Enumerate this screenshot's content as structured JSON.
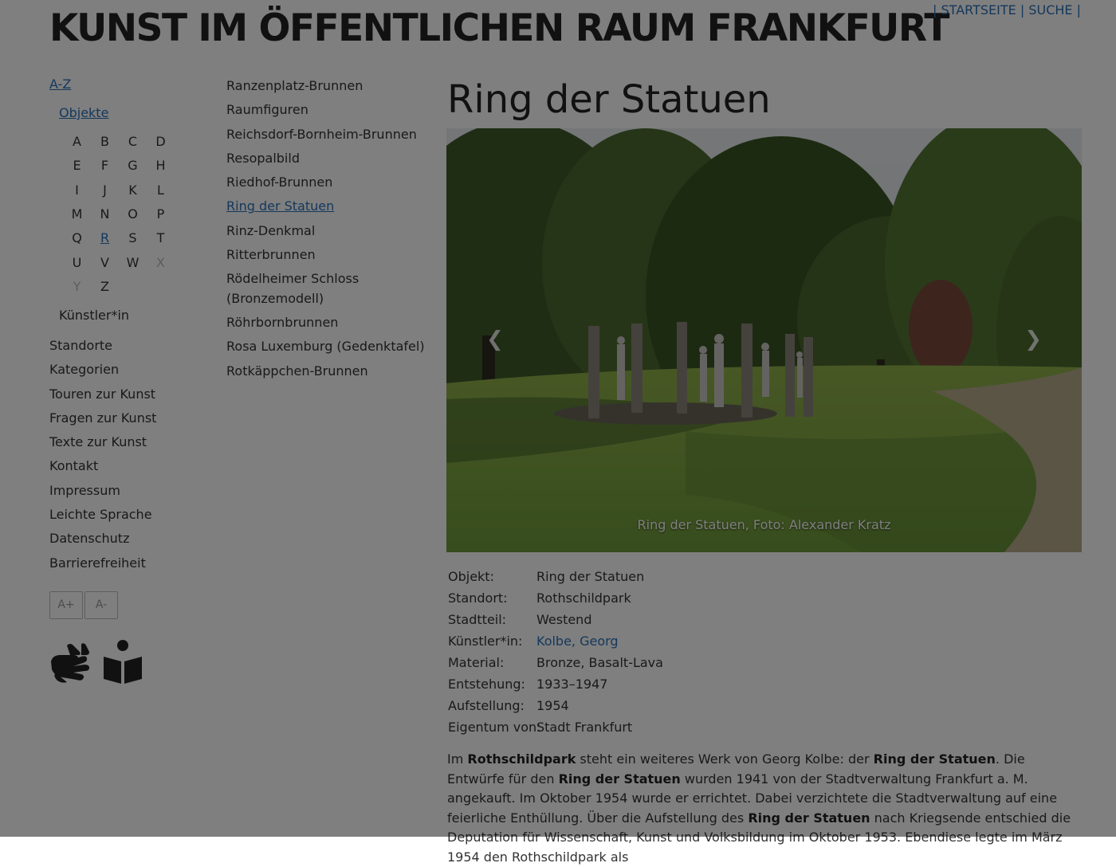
{
  "header": {
    "site_title": "KUNST IM ÖFFENTLICHEN RAUM FRANKFURT",
    "top_links": {
      "separator": "|",
      "home": "STARTSEITE",
      "search": "SUCHE"
    }
  },
  "nav": {
    "az": "A-Z",
    "objekte": "Objekte",
    "letters": [
      {
        "l": "A",
        "state": "normal"
      },
      {
        "l": "B",
        "state": "normal"
      },
      {
        "l": "C",
        "state": "normal"
      },
      {
        "l": "D",
        "state": "normal"
      },
      {
        "l": "E",
        "state": "normal"
      },
      {
        "l": "F",
        "state": "normal"
      },
      {
        "l": "G",
        "state": "normal"
      },
      {
        "l": "H",
        "state": "normal"
      },
      {
        "l": "I",
        "state": "normal"
      },
      {
        "l": "J",
        "state": "normal"
      },
      {
        "l": "K",
        "state": "normal"
      },
      {
        "l": "L",
        "state": "normal"
      },
      {
        "l": "M",
        "state": "normal"
      },
      {
        "l": "N",
        "state": "normal"
      },
      {
        "l": "O",
        "state": "normal"
      },
      {
        "l": "P",
        "state": "normal"
      },
      {
        "l": "Q",
        "state": "normal"
      },
      {
        "l": "R",
        "state": "active"
      },
      {
        "l": "S",
        "state": "normal"
      },
      {
        "l": "T",
        "state": "normal"
      },
      {
        "l": "U",
        "state": "normal"
      },
      {
        "l": "V",
        "state": "normal"
      },
      {
        "l": "W",
        "state": "normal"
      },
      {
        "l": "X",
        "state": "disabled"
      },
      {
        "l": "Y",
        "state": "disabled"
      },
      {
        "l": "Z",
        "state": "normal"
      }
    ],
    "kuenstler": "Künstler*in",
    "main_links": [
      "Standorte",
      "Kategorien",
      "Touren zur Kunst",
      "Fragen zur Kunst",
      "Texte zur Kunst",
      "Kontakt",
      "Impressum",
      "Leichte Sprache",
      "Datenschutz",
      "Barrierefreiheit"
    ],
    "font_larger": "A+",
    "font_smaller": "A-"
  },
  "objects": {
    "items": [
      "Ranzenplatz-Brunnen",
      "Raumfiguren",
      "Reichsdorf-Bornheim-Brunnen",
      "Resopalbild",
      "Riedhof-Brunnen",
      "Ring der Statuen",
      "Rinz-Denkmal",
      "Ritterbrunnen",
      "Rödelheimer Schloss (Bronzemodell)",
      "Röhrbornbrunnen",
      "Rosa Luxemburg (Gedenktafel)",
      "Rotkäppchen-Brunnen"
    ],
    "current_index": 5
  },
  "main": {
    "title": "Ring der Statuen",
    "photo_caption": "Ring der Statuen, Foto: Alexander Kratz",
    "details": [
      {
        "label": "Objekt:",
        "value": "Ring der Statuen",
        "link": false
      },
      {
        "label": "Standort:",
        "value": "Rothschildpark",
        "link": false
      },
      {
        "label": "Stadtteil:",
        "value": "Westend",
        "link": false
      },
      {
        "label": "Künstler*in:",
        "value": "Kolbe, Georg",
        "link": true
      },
      {
        "label": "Material:",
        "value": "Bronze, Basalt-Lava",
        "link": false
      },
      {
        "label": "Entstehung:",
        "value": "1933–1947",
        "link": false
      },
      {
        "label": "Aufstellung:",
        "value": "1954",
        "link": false
      },
      {
        "label": "Eigentum von:",
        "value": "Stadt Frankfurt",
        "link": false
      }
    ],
    "description": [
      {
        "t": "Im ",
        "b": false
      },
      {
        "t": "Rothschildpark",
        "b": true
      },
      {
        "t": " steht ein weiteres Werk von Georg Kolbe: der ",
        "b": false
      },
      {
        "t": "Ring der Statuen",
        "b": true
      },
      {
        "t": ". Die Entwürfe für den ",
        "b": false
      },
      {
        "t": "Ring der Statuen",
        "b": true
      },
      {
        "t": " wurden 1941 von der Stadtverwaltung Frankfurt a. M. angekauft. Im Oktober 1954 wurde er errichtet. Dabei verzichtete die Stadtverwaltung auf eine feierliche Enthüllung. Über die Aufstellung des ",
        "b": false
      },
      {
        "t": "Ring der Statuen",
        "b": true
      },
      {
        "t": " nach Kriegsende entschied die Deputation für Wissenschaft, Kunst und Volksbildung im Oktober 1953. Ebendiese legte im März 1954 den Rothschildpark als",
        "b": false
      }
    ]
  },
  "colors": {
    "link": "#2a70b8",
    "overlay": "rgba(0,0,0,0.5)"
  }
}
